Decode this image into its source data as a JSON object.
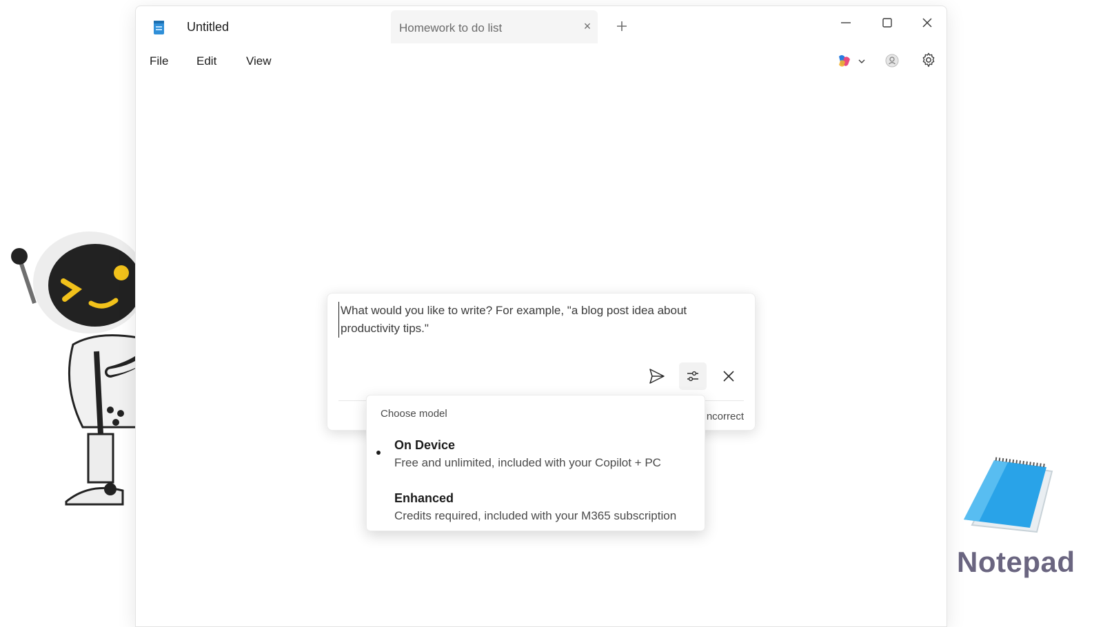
{
  "window": {
    "active_tab_title": "Untitled",
    "inactive_tab_title": "Homework to do list",
    "tab_close_glyph": "×",
    "icons": [
      "notepad-app-icon",
      "close-icon",
      "plus-icon",
      "minimize-icon",
      "maximize-icon",
      "close-window-icon"
    ]
  },
  "menu": {
    "file": "File",
    "edit": "Edit",
    "view": "View",
    "right_icons": [
      "copilot-icon",
      "chevron-down-icon",
      "account-icon",
      "gear-icon"
    ]
  },
  "write_panel": {
    "prompt": "What would you like to write? For example, \"a blog post idea about productivity tips.\"",
    "feedback_partial": "ncorrect",
    "icons": [
      "send-icon",
      "options-icon",
      "close-icon"
    ]
  },
  "model_menu": {
    "header": "Choose model",
    "options": [
      {
        "title": "On Device",
        "description": "Free and unlimited, included with your Copilot + PC",
        "selected": true
      },
      {
        "title": "Enhanced",
        "description": "Credits required, included with your M365 subscription",
        "selected": false
      }
    ]
  },
  "branding": {
    "logo_text": "Notepad"
  },
  "colors": {
    "accent_blue": "#29a3e8",
    "text_primary": "#1b1b1b",
    "text_secondary": "#4a4a4a",
    "logo_text": "#6a6580",
    "robot_yellow": "#f2c21b"
  }
}
